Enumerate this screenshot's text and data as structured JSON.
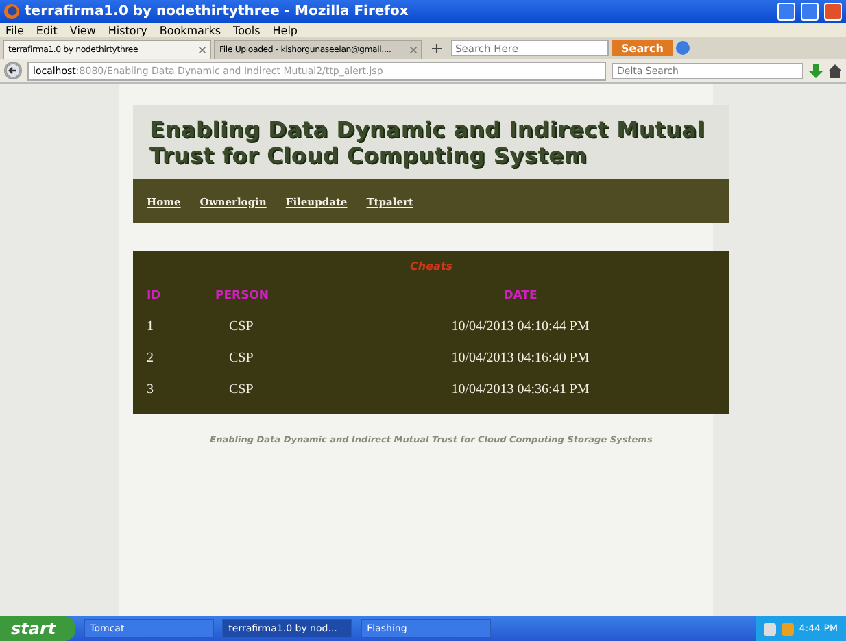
{
  "window": {
    "title": "terrafirma1.0 by nodethirtythree - Mozilla Firefox"
  },
  "menu": [
    "File",
    "Edit",
    "View",
    "History",
    "Bookmarks",
    "Tools",
    "Help"
  ],
  "tabs": [
    {
      "label": "terrafirma1.0 by nodethirtythree",
      "selected": true
    },
    {
      "label": "File Uploaded - kishorgunaseelan@gmail....",
      "selected": false
    }
  ],
  "toolbar_search": {
    "placeholder": "Search Here",
    "button": "Search"
  },
  "address": {
    "host": "localhost",
    "path": ":8080/Enabling Data Dynamic and Indirect Mutual2/ttp_alert.jsp"
  },
  "engine_search": {
    "placeholder": "Delta Search"
  },
  "page": {
    "heading": "Enabling Data Dynamic and Indirect Mutual Trust for Cloud Computing System",
    "nav": [
      "Home",
      "Ownerlogin",
      "Fileupdate",
      "Ttpalert"
    ],
    "table": {
      "caption": "Cheats",
      "columns": [
        "ID",
        "PERSON",
        "DATE"
      ],
      "rows": [
        [
          "1",
          "CSP",
          "10/04/2013 04:10:44 PM"
        ],
        [
          "2",
          "CSP",
          "10/04/2013 04:16:40 PM"
        ],
        [
          "3",
          "CSP",
          "10/04/2013 04:36:41 PM"
        ]
      ]
    },
    "footer": "Enabling Data Dynamic and Indirect Mutual Trust for Cloud Computing Storage Systems"
  },
  "taskbar": {
    "start": "start",
    "items": [
      {
        "label": "Tomcat",
        "selected": false
      },
      {
        "label": "terrafirma1.0 by nod...",
        "selected": true
      },
      {
        "label": "Flashing",
        "selected": false
      }
    ],
    "clock": "4:44 PM"
  }
}
